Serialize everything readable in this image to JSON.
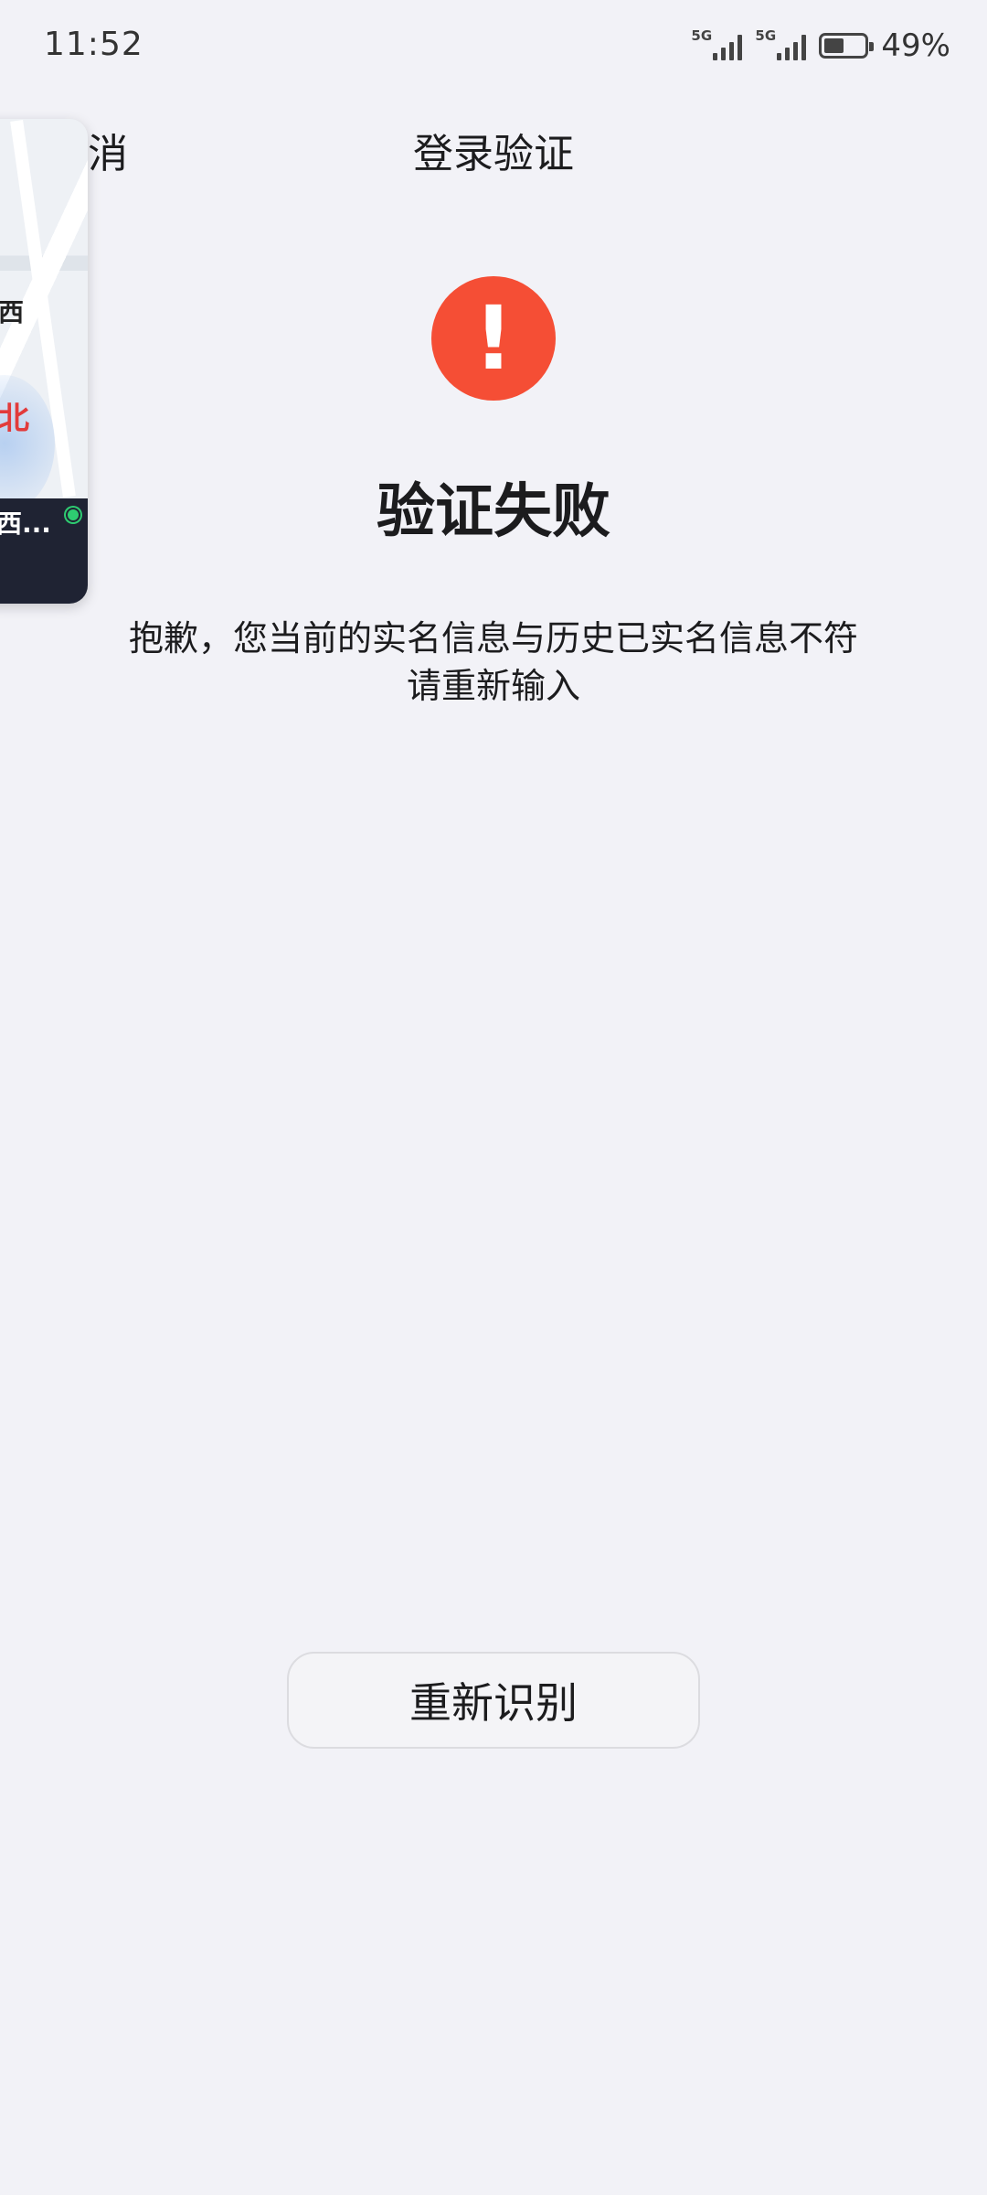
{
  "status_bar": {
    "time": "11:52",
    "network_1": "5G",
    "network_2": "5G",
    "battery_percent": "49%",
    "battery_level": 0.49
  },
  "header": {
    "title": "登录验证",
    "cancel_label": "消"
  },
  "mini_window": {
    "label_top": "西",
    "label_red": "北",
    "bottom_text": "西..."
  },
  "error": {
    "icon_glyph": "!",
    "icon": "exclamation-icon",
    "color": "#f54e35",
    "title": "验证失败",
    "desc_line1": "抱歉，您当前的实名信息与历史已实名信息不符",
    "desc_line2": "请重新输入"
  },
  "actions": {
    "retry_label": "重新识别"
  }
}
